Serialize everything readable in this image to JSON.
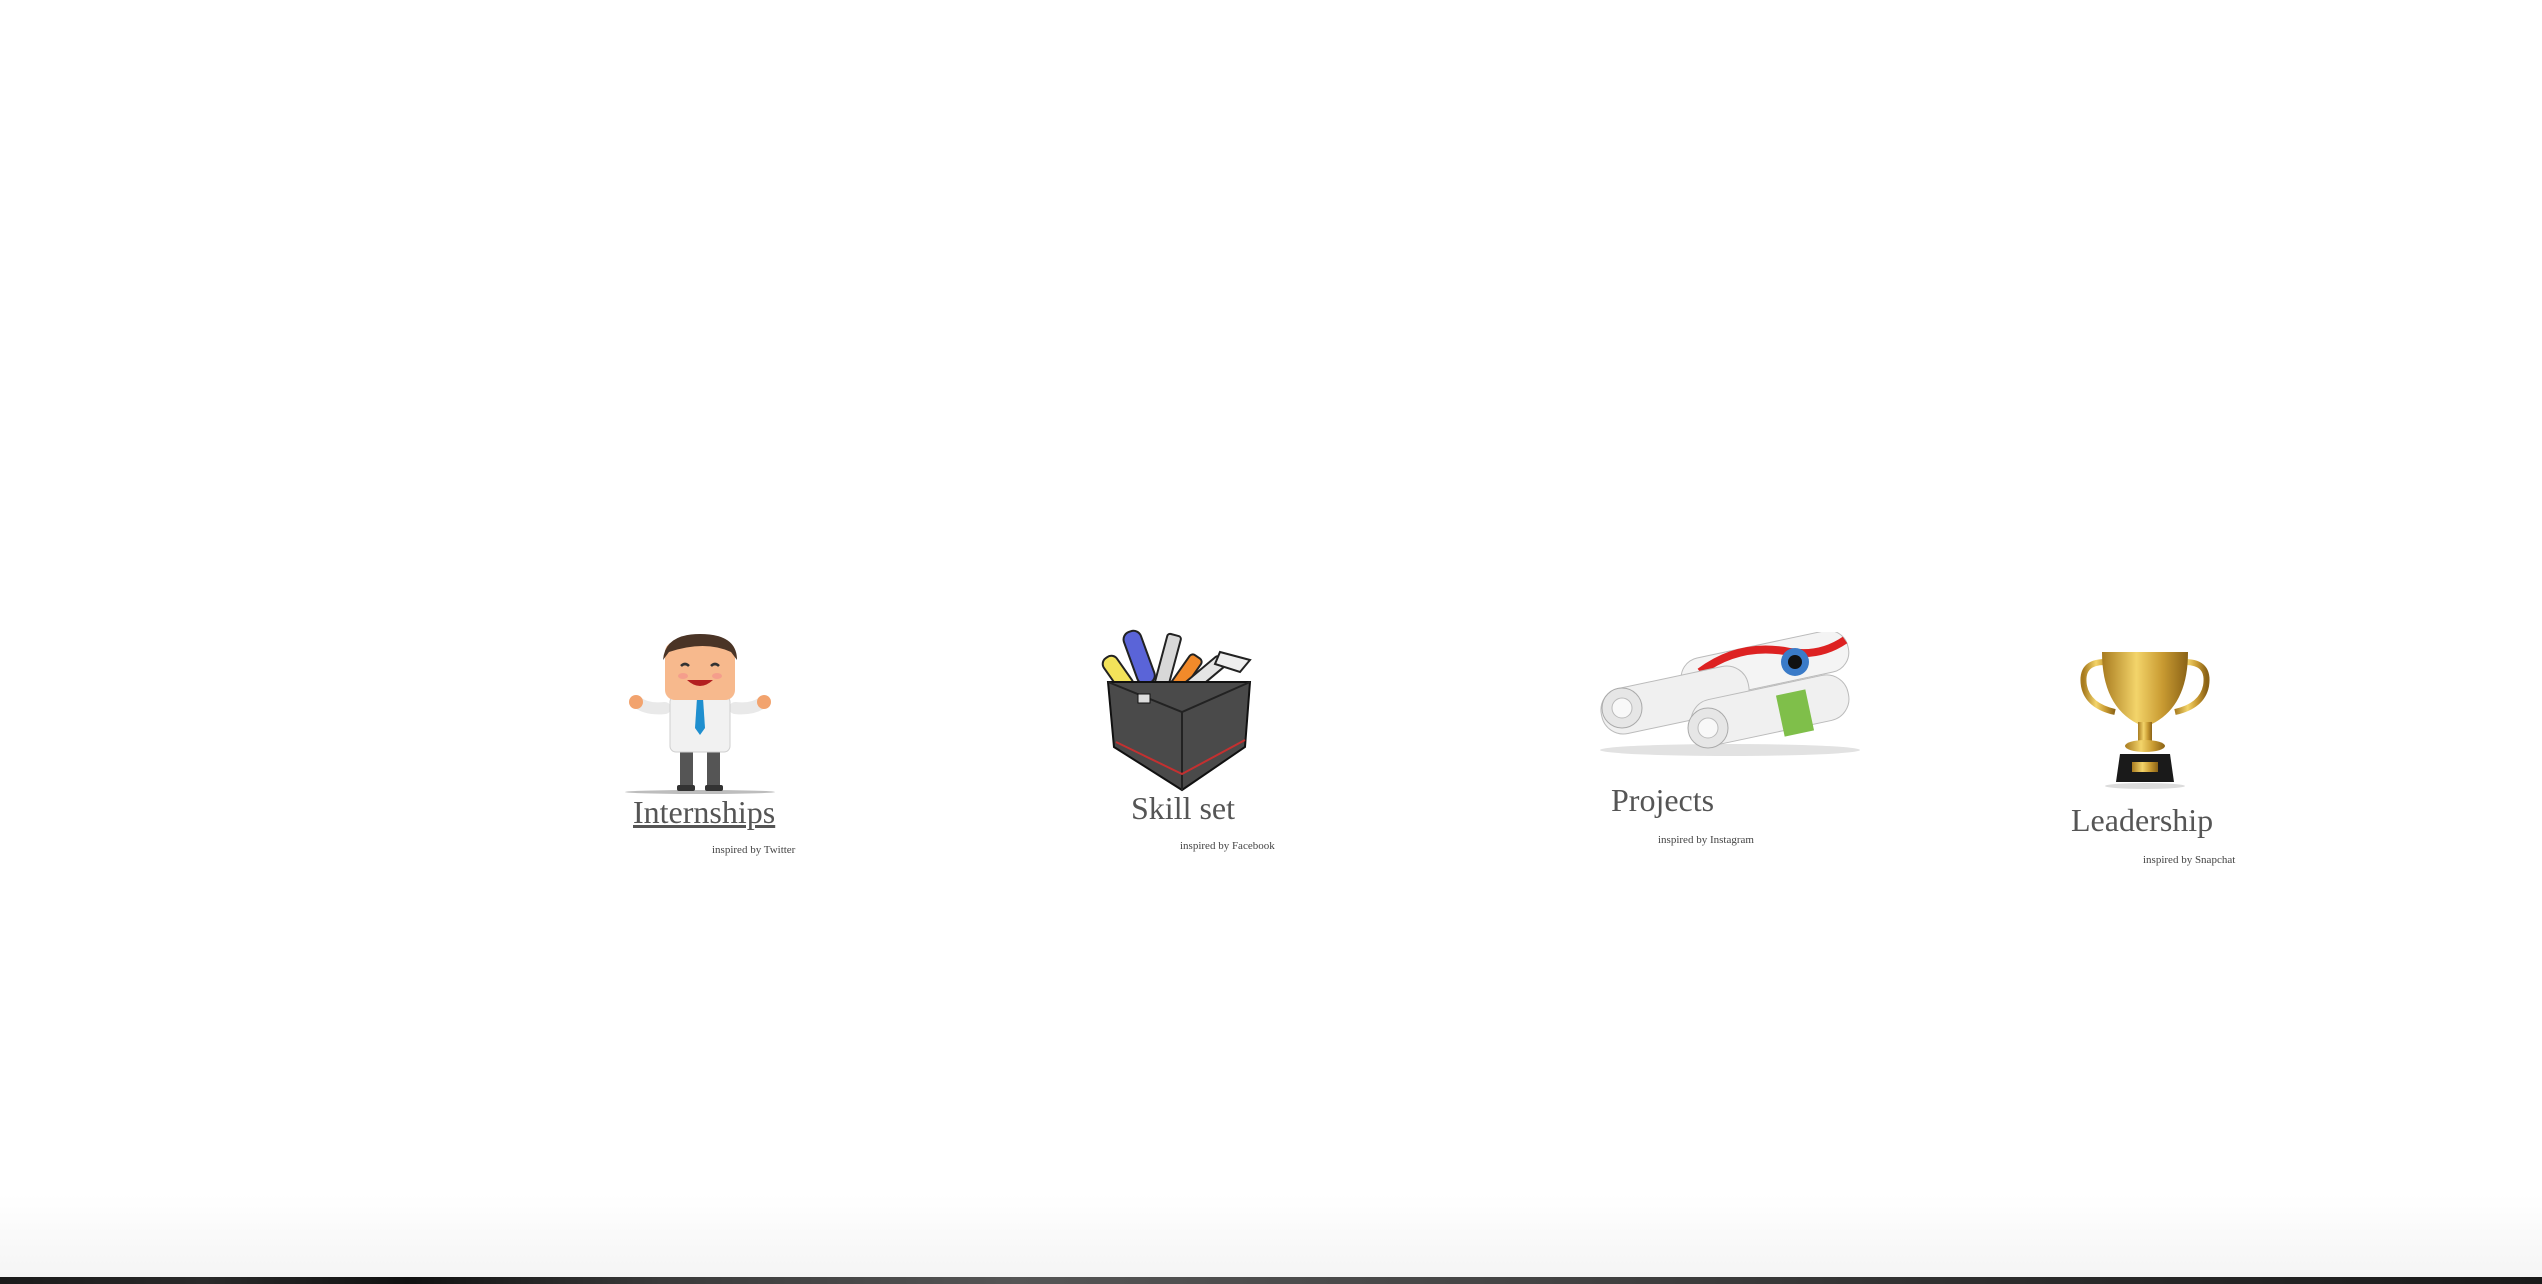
{
  "items": [
    {
      "title": "Internships",
      "subtitle": "inspired by Twitter",
      "icon": "businessman-icon"
    },
    {
      "title": "Skill set",
      "subtitle": "inspired by Facebook",
      "icon": "toolbox-icon"
    },
    {
      "title": "Projects",
      "subtitle": "inspired by Instagram",
      "icon": "rolled-papers-icon"
    },
    {
      "title": "Leadership",
      "subtitle": "inspired by Snapchat",
      "icon": "trophy-icon"
    }
  ]
}
